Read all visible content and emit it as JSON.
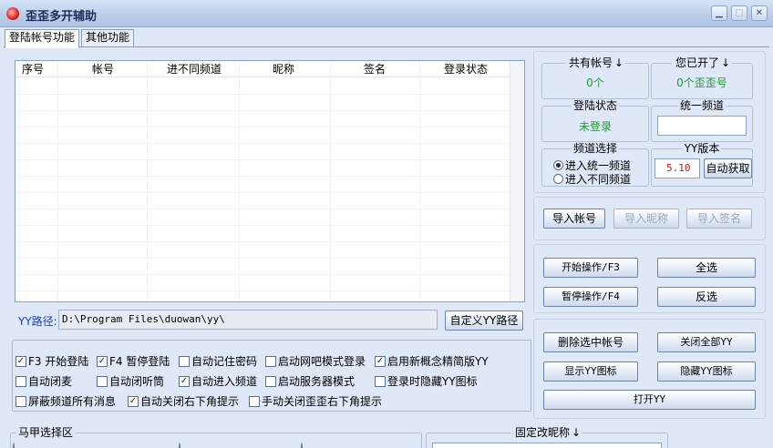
{
  "window": {
    "title": "歪歪多开辅助",
    "controls": [
      "minimize",
      "maximize",
      "close"
    ]
  },
  "tabs": [
    {
      "label": "登陆帐号功能",
      "active": true
    },
    {
      "label": "其他功能",
      "active": false
    }
  ],
  "table": {
    "columns": [
      "序号",
      "帐号",
      "进不同频道",
      "昵称",
      "签名",
      "登录状态"
    ],
    "rows": []
  },
  "path": {
    "label": "YY路径:",
    "value": "D:\\Program Files\\duowan\\yy\\",
    "browse_button": "自定义YY路径"
  },
  "options": [
    {
      "label": "F3 开始登陆",
      "checked": true
    },
    {
      "label": "F4 暂停登陆",
      "checked": true
    },
    {
      "label": "自动记住密码",
      "checked": false
    },
    {
      "label": "启动网吧模式登录",
      "checked": false
    },
    {
      "label": "启用新概念精简版YY",
      "checked": true
    },
    {
      "label": "自动闭麦",
      "checked": false
    },
    {
      "label": "自动闭听筒",
      "checked": false
    },
    {
      "label": "自动进入频道",
      "checked": true
    },
    {
      "label": "启动服务器模式",
      "checked": false
    },
    {
      "label": "登录时隐藏YY图标",
      "checked": false
    },
    {
      "label": "屏蔽频道所有消息",
      "checked": false
    },
    {
      "label": "自动关闭右下角提示",
      "checked": true
    },
    {
      "label": "手动关闭歪歪右下角提示",
      "checked": false
    }
  ],
  "vest_section": {
    "label": "马甲选择区",
    "fixed_nick_label": "固定改昵称"
  },
  "info": {
    "total_accounts_label": "共有帐号",
    "total_accounts_value": "0个",
    "opened_label": "您已开了",
    "opened_value": "0个歪歪号",
    "login_status_label": "登陆状态",
    "login_status_value": "未登录",
    "unified_channel_label": "统一频道",
    "unified_channel_value": "",
    "channel_select_label": "频道选择",
    "channel_options": [
      {
        "label": "进入统一频道",
        "selected": true
      },
      {
        "label": "进入不同频道",
        "selected": false
      }
    ],
    "yy_version_label": "YY版本",
    "yy_version_value": "5.10",
    "auto_get_button": "自动获取"
  },
  "import_buttons": {
    "import_account": "导入帐号",
    "import_nick": "导入昵称",
    "import_sign": "导入签名"
  },
  "ops_buttons": {
    "start": "开始操作/F3",
    "select_all": "全选",
    "pause": "暂停操作/F4",
    "invert": "反选"
  },
  "manage_buttons": {
    "delete_selected": "删除选中帐号",
    "close_all_yy": "关闭全部YY",
    "show_icon": "显示YY图标",
    "hide_icon": "隐藏YY图标",
    "open_yy": "打开YY"
  },
  "colors": {
    "green_value": "#1f9a35",
    "blue_label": "#1a3fc0",
    "version_red": "#c01818"
  }
}
